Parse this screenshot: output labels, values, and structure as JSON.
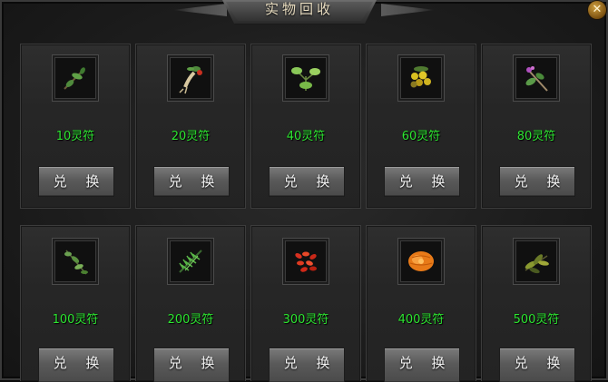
{
  "window": {
    "title": "实物回收",
    "close_icon": "close-icon"
  },
  "accent_colors": {
    "price_text": "#2ee632",
    "close_button": "#c89638"
  },
  "items": [
    {
      "price": "10灵符",
      "button": "兑 换",
      "icon": "herb-sprig-icon"
    },
    {
      "price": "20灵符",
      "button": "兑 换",
      "icon": "ginseng-root-icon"
    },
    {
      "price": "40灵符",
      "button": "兑 换",
      "icon": "green-herb-icon"
    },
    {
      "price": "60灵符",
      "button": "兑 换",
      "icon": "golden-berries-icon"
    },
    {
      "price": "80灵符",
      "button": "兑 换",
      "icon": "purple-flower-herb-icon"
    },
    {
      "price": "100灵符",
      "button": "兑 换",
      "icon": "leafy-vine-icon"
    },
    {
      "price": "200灵符",
      "button": "兑 换",
      "icon": "pine-needle-herb-icon"
    },
    {
      "price": "300灵符",
      "button": "兑 换",
      "icon": "red-goji-icon"
    },
    {
      "price": "400灵符",
      "button": "兑 换",
      "icon": "orange-fruit-icon"
    },
    {
      "price": "500灵符",
      "button": "兑 换",
      "icon": "dark-leaf-herb-icon"
    }
  ]
}
